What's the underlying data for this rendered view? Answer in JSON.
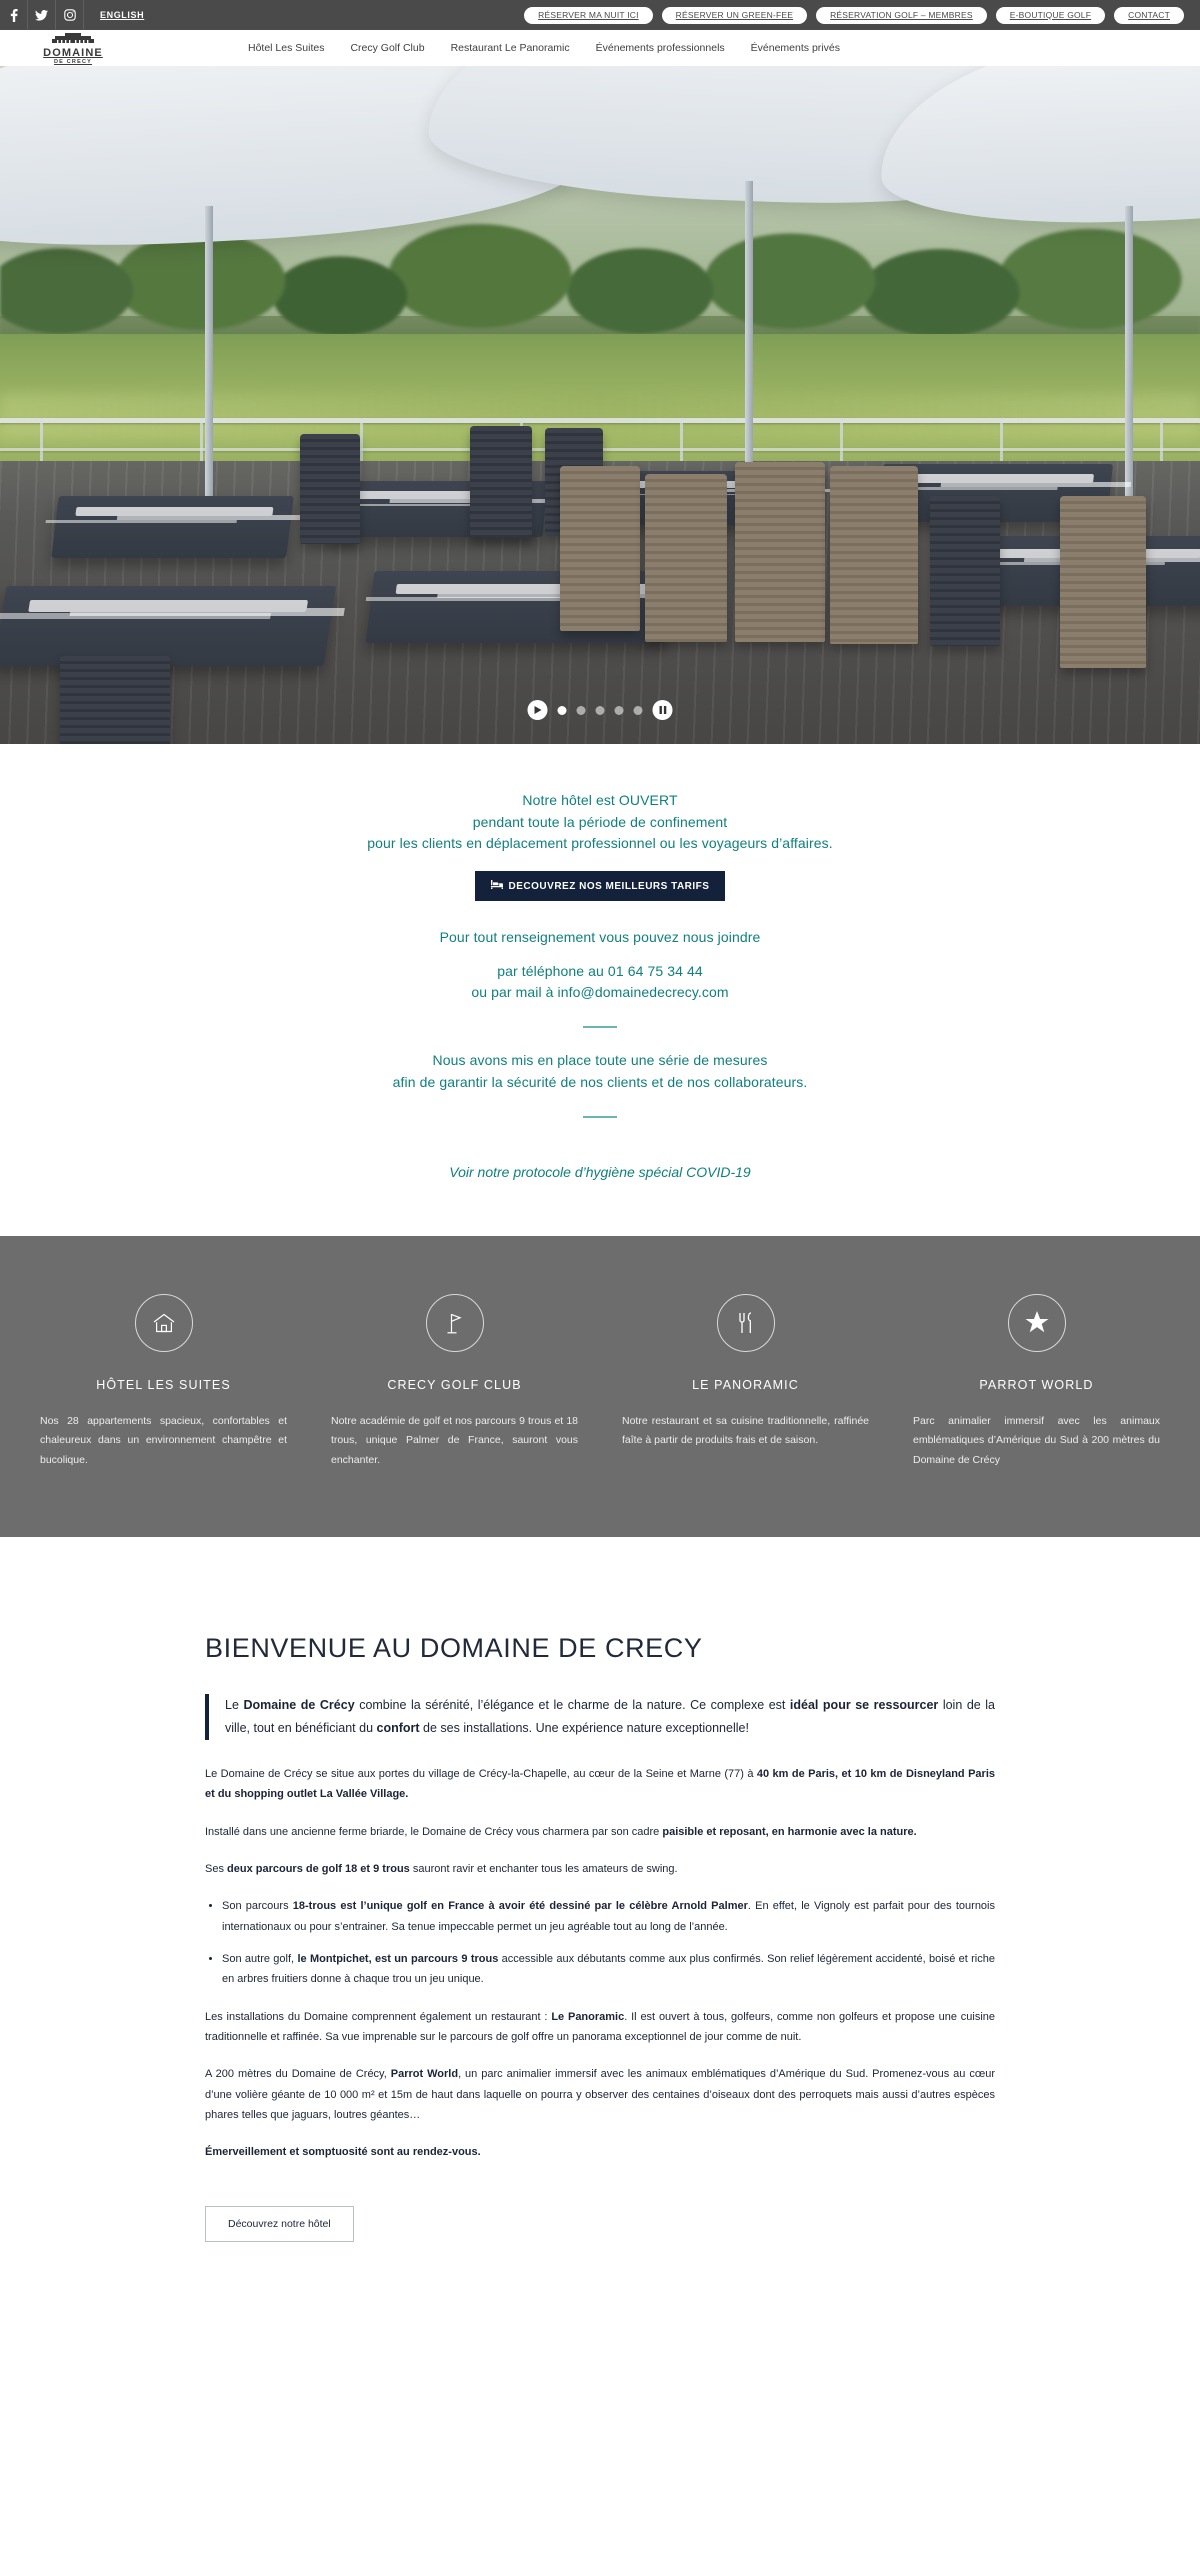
{
  "topbar": {
    "social": [
      {
        "name": "facebook-icon",
        "label": "Facebook"
      },
      {
        "name": "twitter-icon",
        "label": "Twitter"
      },
      {
        "name": "instagram-icon",
        "label": "Instagram"
      }
    ],
    "language": "ENGLISH",
    "buttons": [
      "RÉSERVER MA NUIT ICI",
      "RÉSERVER UN GREEN-FEE",
      "RÉSERVATION GOLF – MEMBRES",
      "E-BOUTIQUE GOLF",
      "CONTACT"
    ]
  },
  "header": {
    "logo_name": "DOMAINE",
    "logo_sub": "DE CRECY",
    "nav": [
      "Hôtel Les Suites",
      "Crecy Golf Club",
      "Restaurant Le Panoramic",
      "Événements professionnels",
      "Événements privés"
    ]
  },
  "hero": {
    "alt": "Terrasse du restaurant Le Panoramic avec vue sur le parcours de golf",
    "slides": 5,
    "active_slide": 1,
    "pause_label": "❚❚"
  },
  "info": {
    "line1": "Notre hôtel est OUVERT",
    "line2": "pendant toute la période de confinement",
    "line3": "pour les clients en déplacement professionnel ou les voyageurs d’affaires.",
    "cta_icon": "bed-icon",
    "cta_label": "DECOUVREZ NOS MEILLEURS TARIFS",
    "line4": "Pour tout renseignement vous pouvez nous joindre",
    "line5": "par téléphone au 01 64 75 34 44",
    "line6": "ou par mail à info@domainedecrecy.com",
    "line7": "Nous avons mis en place toute une série de mesures",
    "line8": "afin de garantir la sécurité de nos clients et de nos collaborateurs.",
    "protocol": "Voir notre protocole d’hygiène spécial COVID-19",
    "accent_color": "#10807e"
  },
  "features": {
    "background": "#6d6d6d",
    "items": [
      {
        "icon": "home-icon",
        "title": "HÔTEL LES SUITES",
        "text": "Nos 28 appartements spacieux, confortables et chaleureux dans un environnement champêtre et bucolique."
      },
      {
        "icon": "golf-flag-icon",
        "title": "CRECY GOLF CLUB",
        "text": "Notre académie de golf et nos parcours 9 trous et 18 trous, unique Palmer de France, sauront vous enchanter."
      },
      {
        "icon": "cutlery-icon",
        "title": "LE PANORAMIC",
        "text": "Notre restaurant et sa cuisine traditionnelle, raffinée faîte à partir de produits frais et de saison."
      },
      {
        "icon": "star-icon",
        "title": "PARROT WORLD",
        "text": "Parc animalier immersif avec les animaux emblématiques d’Amérique du Sud à 200 mètres du Domaine de Crécy"
      }
    ]
  },
  "article": {
    "title": "BIENVENUE AU DOMAINE DE CRECY",
    "lead_parts": {
      "a": "Le ",
      "b1": "Domaine de Crécy",
      "c": " combine la sérénité, l’élégance et le charme de la nature. Ce complexe est ",
      "b2": "idéal pour se ressourcer",
      "d": " loin de la ville, tout en bénéficiant du ",
      "b3": "confort",
      "e": " de ses installations. Une expérience nature exceptionnelle!"
    },
    "p1_a": "Le Domaine de Crécy se situe aux portes du village de Crécy-la-Chapelle, au cœur de la Seine et Marne (77) à ",
    "p1_b": "40 km de Paris, et 10 km de Disneyland Paris et du shopping outlet La Vallée Village.",
    "p2_a": "Installé dans une ancienne ferme briarde, le Domaine de Crécy vous charmera par son cadre ",
    "p2_b": "paisible et reposant, en harmonie avec la nature.",
    "p3_a": "Ses ",
    "p3_b": "deux parcours de golf 18 et 9 trous",
    "p3_c": " sauront ravir et enchanter tous les amateurs de swing.",
    "li1_a": "Son parcours ",
    "li1_b": "18-trous est l’unique golf en France à avoir été dessiné par le célèbre Arnold Palmer",
    "li1_c": ". En effet, le Vignoly est parfait pour des tournois internationaux ou pour s’entrainer. Sa tenue impeccable permet un jeu agréable tout au long de l’année.",
    "li2_a": "Son autre golf, ",
    "li2_b": "le Montpichet, est un parcours 9 trous",
    "li2_c": " accessible aux débutants comme aux plus confirmés. Son relief légèrement accidenté, boisé et riche en arbres fruitiers donne à chaque trou un jeu unique.",
    "p4_a": "Les installations du Domaine comprennent également un restaurant : ",
    "p4_b": "Le Panoramic",
    "p4_c": ". Il est ouvert à tous, golfeurs, comme non golfeurs et propose une cuisine traditionnelle et raffinée. Sa vue imprenable sur le parcours de golf offre un panorama exceptionnel de jour comme de nuit.",
    "p5_a": "A 200 mètres du Domaine de Crécy, ",
    "p5_b": "Parrot World",
    "p5_c": ", un parc animalier immersif avec les animaux emblématiques d’Amérique du Sud. Promenez-vous au cœur d’une volière géante de 10 000 m² et 15m de haut dans laquelle on pourra y observer des centaines d’oiseaux dont des perroquets mais aussi d’autres espèces phares telles que jaguars, loutres géantes…",
    "p6": "Émerveillement et somptuosité sont au rendez-vous.",
    "button": "Découvrez notre hôtel"
  }
}
